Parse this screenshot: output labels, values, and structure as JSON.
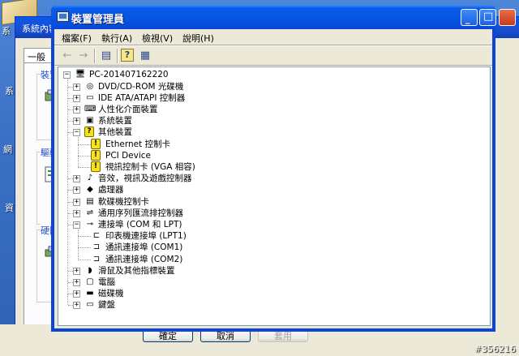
{
  "desktop": {
    "side_labels": [
      "系",
      "系",
      "網",
      "資"
    ],
    "watermark": "#356216"
  },
  "sysprops": {
    "title": "系統內容",
    "tab": "一般",
    "groups": [
      "裝置",
      "驅動",
      "硬體"
    ],
    "buttons": {
      "ok": "確定",
      "cancel": "取消",
      "apply": "套用"
    }
  },
  "window": {
    "title": "裝置管理員",
    "minimize": "_",
    "maximize": "□",
    "close": "✕"
  },
  "menu": [
    "檔案(F)",
    "執行(A)",
    "檢視(V)",
    "說明(H)"
  ],
  "toolbar": {
    "back": "←",
    "forward": "→",
    "b1": "▤",
    "b2": "?",
    "b3": "▦"
  },
  "tree": {
    "root": "PC-201407162220",
    "items": [
      {
        "label": "DVD/CD-ROM 光碟機",
        "icon": "cdrom-icon",
        "exp": "+"
      },
      {
        "label": "IDE ATA/ATAPI 控制器",
        "icon": "ide-controller-icon",
        "exp": "+"
      },
      {
        "label": "人性化介面裝置",
        "icon": "hid-icon",
        "exp": "+"
      },
      {
        "label": "系統裝置",
        "icon": "system-device-icon",
        "exp": "+"
      },
      {
        "label": "其他裝置",
        "icon": "other-device-icon",
        "exp": "-"
      },
      {
        "label": "Ethernet 控制卡",
        "icon": "warning-device-icon",
        "exp": "",
        "child": true
      },
      {
        "label": "PCI Device",
        "icon": "warning-device-icon",
        "exp": "",
        "child": true
      },
      {
        "label": "視訊控制卡 (VGA 相容)",
        "icon": "warning-device-icon",
        "exp": "",
        "child": true
      },
      {
        "label": "音效，視訊及遊戲控制器",
        "icon": "sound-icon",
        "exp": "+"
      },
      {
        "label": "處理器",
        "icon": "processor-icon",
        "exp": "+"
      },
      {
        "label": "軟碟機控制卡",
        "icon": "floppy-controller-icon",
        "exp": "+"
      },
      {
        "label": "通用序列匯流排控制器",
        "icon": "usb-icon",
        "exp": "+"
      },
      {
        "label": "連接埠 (COM 和 LPT)",
        "icon": "port-icon",
        "exp": "-"
      },
      {
        "label": "印表機連接埠 (LPT1)",
        "icon": "printer-port-icon",
        "exp": "",
        "child": true
      },
      {
        "label": "通訊連接埠 (COM1)",
        "icon": "com-port-icon",
        "exp": "",
        "child": true
      },
      {
        "label": "通訊連接埠 (COM2)",
        "icon": "com-port-icon",
        "exp": "",
        "child": true
      },
      {
        "label": "滑鼠及其他指標裝置",
        "icon": "mouse-icon",
        "exp": "+"
      },
      {
        "label": "電腦",
        "icon": "computer-icon",
        "exp": "+"
      },
      {
        "label": "磁碟機",
        "icon": "disk-icon",
        "exp": "+"
      },
      {
        "label": "鍵盤",
        "icon": "keyboard-icon",
        "exp": "+"
      }
    ]
  }
}
